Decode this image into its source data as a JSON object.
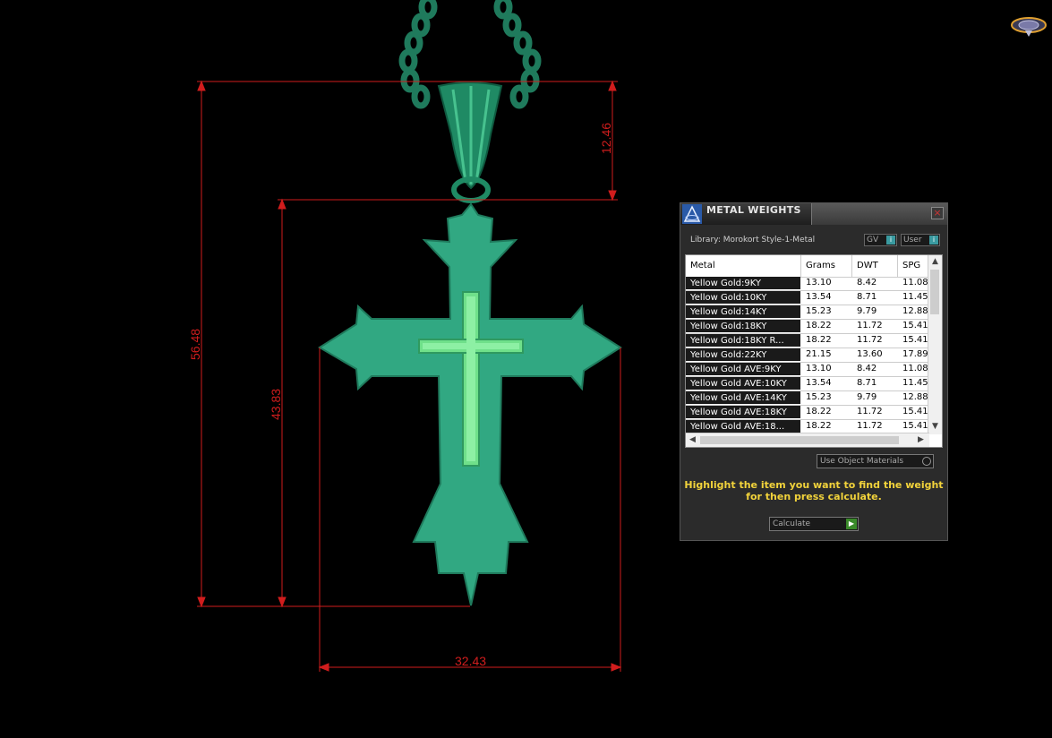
{
  "dimensions": {
    "overall_height": "56.48",
    "body_height": "43.83",
    "bail_height": "12.46",
    "width": "32.43"
  },
  "colors": {
    "background": "#000000",
    "dimension_lines": "#d11d1d",
    "cross_fill": "#31a882",
    "cross_inlay": "#6fe08a",
    "instruction_text": "#f2d33b"
  },
  "panel": {
    "title": "METAL WEIGHTS",
    "close_icon": "close-icon",
    "library_label": "Library: Morokort Style-1-Metal",
    "gv_select": "GV",
    "user_select": "User",
    "columns": [
      "Metal",
      "Grams",
      "DWT",
      "SPG"
    ],
    "rows": [
      {
        "metal": "Yellow Gold:9KY",
        "grams": "13.10",
        "dwt": "8.42",
        "spg": "11.08"
      },
      {
        "metal": "Yellow Gold:10KY",
        "grams": "13.54",
        "dwt": "8.71",
        "spg": "11.45"
      },
      {
        "metal": "Yellow Gold:14KY",
        "grams": "15.23",
        "dwt": "9.79",
        "spg": "12.88"
      },
      {
        "metal": "Yellow Gold:18KY",
        "grams": "18.22",
        "dwt": "11.72",
        "spg": "15.41"
      },
      {
        "metal": "Yellow Gold:18KY R...",
        "grams": "18.22",
        "dwt": "11.72",
        "spg": "15.41"
      },
      {
        "metal": "Yellow Gold:22KY",
        "grams": "21.15",
        "dwt": "13.60",
        "spg": "17.89"
      },
      {
        "metal": "Yellow Gold AVE:9KY",
        "grams": "13.10",
        "dwt": "8.42",
        "spg": "11.08"
      },
      {
        "metal": "Yellow Gold AVE:10KY",
        "grams": "13.54",
        "dwt": "8.71",
        "spg": "11.45"
      },
      {
        "metal": "Yellow Gold AVE:14KY",
        "grams": "15.23",
        "dwt": "9.79",
        "spg": "12.88"
      },
      {
        "metal": "Yellow Gold AVE:18KY",
        "grams": "18.22",
        "dwt": "11.72",
        "spg": "15.41"
      },
      {
        "metal": "Yellow Gold AVE:18...",
        "grams": "18.22",
        "dwt": "11.72",
        "spg": "15.41"
      }
    ],
    "use_object_materials": "Use Object Materials",
    "instruction": "Highlight the item you want to find the weight for then press calculate.",
    "instruction_line1": "Highlight the item you want to find the weight",
    "instruction_line2": "for then press calculate.",
    "calculate_label": "Calculate"
  }
}
